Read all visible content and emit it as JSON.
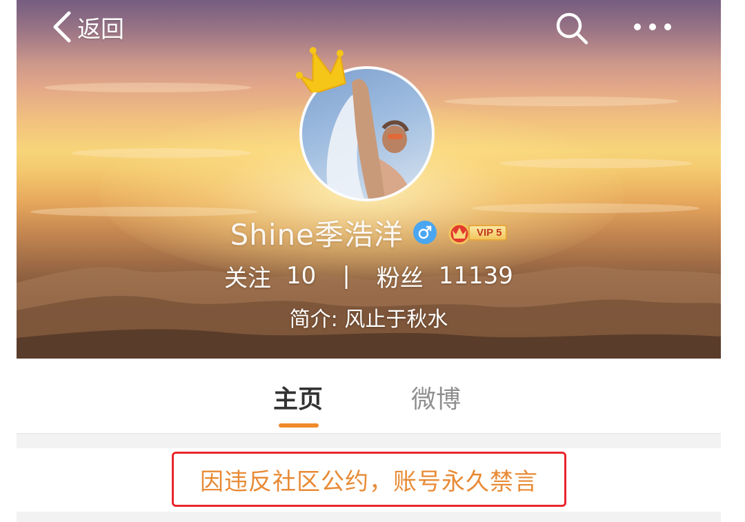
{
  "topbar": {
    "back_label": "返回",
    "back_icon": "chevron-left-icon",
    "search_icon": "search-icon",
    "more_icon": "more-dots-icon"
  },
  "profile": {
    "name": "Shine季浩洋",
    "gender_icon": "male-icon",
    "vip_label": "VIP 5",
    "follow_label": "关注",
    "follow_count": "10",
    "divider": "|",
    "fans_label": "粉丝",
    "fans_count": "11139",
    "bio": "简介: 风止于秋水"
  },
  "tabs": [
    {
      "label": "主页",
      "active": true
    },
    {
      "label": "微博",
      "active": false
    }
  ],
  "notice": {
    "text": "因违反社区公约，账号永久禁言"
  },
  "colors": {
    "accent": "#f08a2a",
    "notice_text": "#e88a35",
    "notice_border": "#e8262b",
    "gender": "#4aa6f0"
  }
}
